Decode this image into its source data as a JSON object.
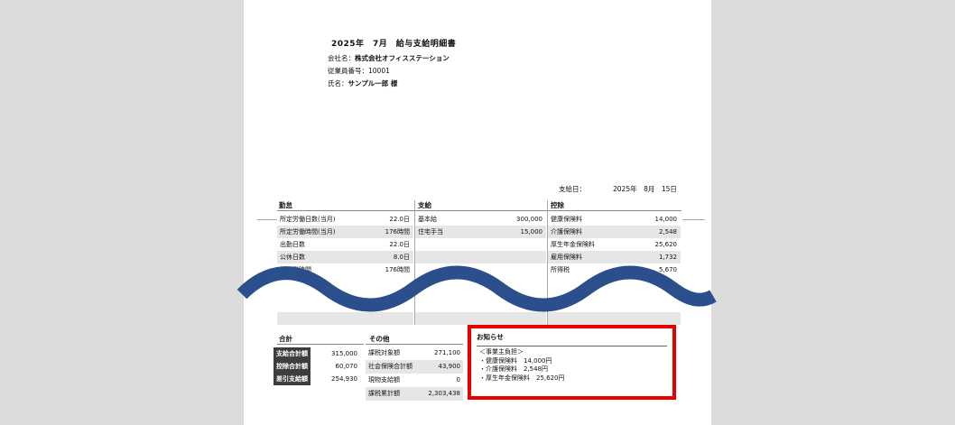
{
  "document": {
    "title": "2025年　7月　給与支給明細書",
    "company_label": "会社名：",
    "company_name": "株式会社オフィスステーション",
    "employee_no_label": "従業員番号：",
    "employee_no": "10001",
    "name_label": "氏名：",
    "name": "サンプル一郎 様",
    "issued_label": "支給日：",
    "issued_date": "2025年　8月　15日"
  },
  "attendance": {
    "title": "勤怠",
    "rows": [
      {
        "label": "所定労働日数(当月)",
        "value": "22.0日"
      },
      {
        "label": "所定労働時間(当月)",
        "value": "176時間"
      },
      {
        "label": "出勤日数",
        "value": "22.0日"
      },
      {
        "label": "公休日数",
        "value": "8.0日"
      },
      {
        "label": "総実働時間",
        "value": "176時間"
      }
    ]
  },
  "payment": {
    "title": "支給",
    "rows": [
      {
        "label": "基本給",
        "value": "300,000"
      },
      {
        "label": "住宅手当",
        "value": "15,000"
      }
    ]
  },
  "deduction": {
    "title": "控除",
    "rows": [
      {
        "label": "健康保険料",
        "value": "14,000"
      },
      {
        "label": "介護保険料",
        "value": "2,548"
      },
      {
        "label": "厚生年金保険料",
        "value": "25,620"
      },
      {
        "label": "雇用保険料",
        "value": "1,732"
      },
      {
        "label": "所得税",
        "value": "5,670"
      }
    ]
  },
  "totals": {
    "title": "合計",
    "rows": [
      {
        "label": "支給合計額",
        "value": "315,000"
      },
      {
        "label": "控除合計額",
        "value": "60,070"
      },
      {
        "label": "差引支給額",
        "value": "254,930"
      }
    ]
  },
  "other": {
    "title": "その他",
    "rows": [
      {
        "label": "課税対象額",
        "value": "271,100"
      },
      {
        "label": "社会保険合計額",
        "value": "43,900"
      },
      {
        "label": "現物支給額",
        "value": "0"
      },
      {
        "label": "課税累計額",
        "value": "2,303,438"
      }
    ]
  },
  "notice": {
    "title": "お知らせ",
    "lines": [
      "＜事業主負担＞",
      "・健康保険料　14,000円",
      "・介護保険料　2,548円",
      "・厚生年金保険料　25,620円"
    ],
    "border_color": "#e60000"
  },
  "wave": {
    "color": "#2b4f8c"
  }
}
